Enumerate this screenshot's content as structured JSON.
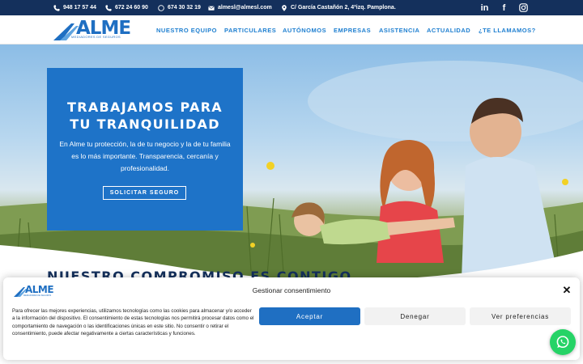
{
  "topbar": {
    "phone1": "948 17 57 44",
    "phone2": "672 24 60 90",
    "whatsapp": "674 30 32 19",
    "email": "almesl@almesl.com",
    "address": "C/ García Castañón 2, 4ºizq. Pamplona.",
    "social": [
      "linkedin-icon",
      "facebook-icon",
      "instagram-icon"
    ]
  },
  "brand": {
    "name": "ALME",
    "tagline": "MEDIADORES DE SEGUROS",
    "color": "#1f6fc2"
  },
  "nav": {
    "items": [
      "NUESTRO EQUIPO",
      "PARTICULARES",
      "AUTÓNOMOS",
      "EMPRESAS",
      "ASISTENCIA",
      "ACTUALIDAD",
      "¿TE LLAMAMOS?"
    ]
  },
  "hero": {
    "title_line1": "TRABAJAMOS PARA",
    "title_line2": "TU TRANQUILIDAD",
    "text": "En Alme tu protección, la de tu negocio y la de tu familia es lo más importante. Transparencia, cercanía y profesionalidad.",
    "button": "SOLICITAR SEGURO"
  },
  "section": {
    "title": "NUESTRO COMPROMISO ES CONTIGO"
  },
  "cookie": {
    "title": "Gestionar consentimiento",
    "text": "Para ofrecer las mejores experiencias, utilizamos tecnologías como las cookies para almacenar y/o acceder a la información del dispositivo. El consentimiento de estas tecnologías nos permitirá procesar datos como el comportamiento de navegación o las identificaciones únicas en este sitio. No consentir o retirar el consentimiento, puede afectar negativamente a ciertas características y funciones.",
    "accept": "Aceptar",
    "deny": "Denegar",
    "preferences": "Ver preferencias"
  },
  "colors": {
    "topbar": "#14305c",
    "accent": "#1e73c8",
    "nav": "#1e7fd0",
    "whatsapp": "#25d366"
  }
}
